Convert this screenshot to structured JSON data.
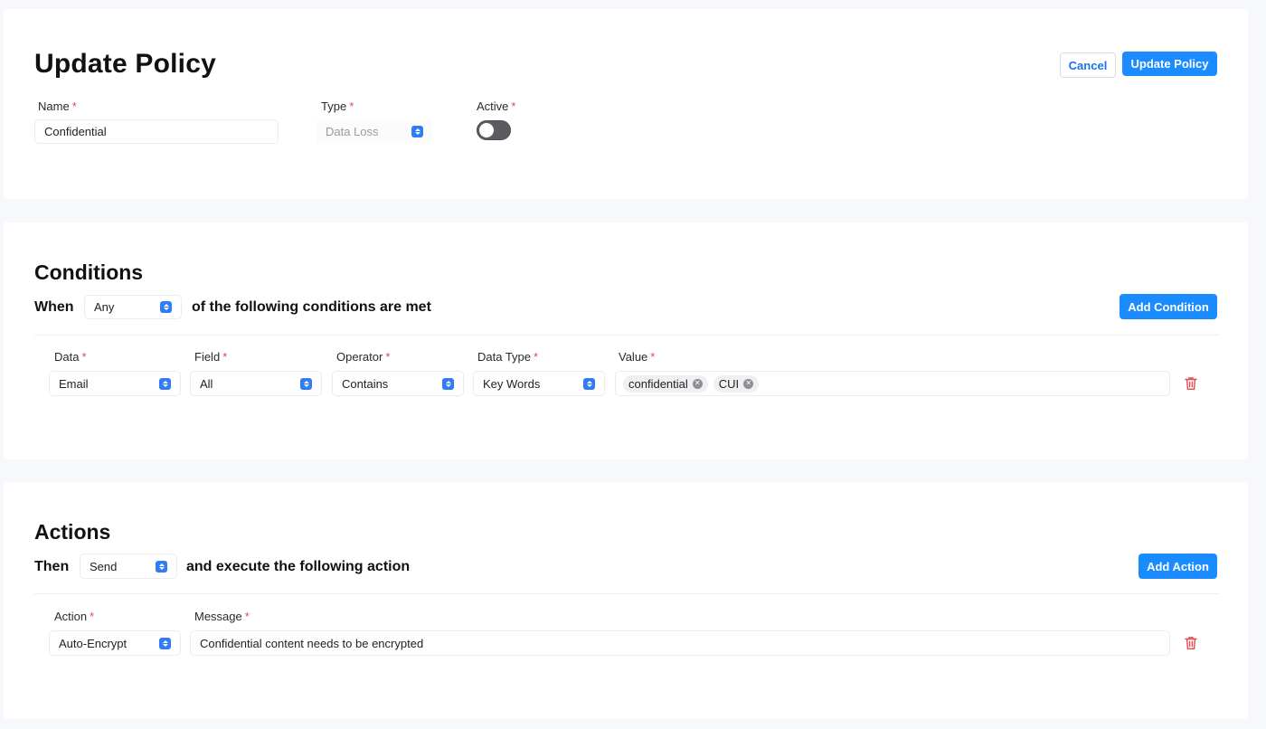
{
  "policy": {
    "title": "Update Policy",
    "cancel_label": "Cancel",
    "submit_label": "Update Policy",
    "name_label": "Name",
    "name_value": "Confidential",
    "type_label": "Type",
    "type_value": "Data Loss",
    "active_label": "Active",
    "required_mark": "*"
  },
  "conditions": {
    "title": "Conditions",
    "when_label": "When",
    "match_value": "Any",
    "match_suffix": "of the following conditions are met",
    "add_label": "Add Condition",
    "columns": {
      "data": "Data",
      "field": "Field",
      "operator": "Operator",
      "data_type": "Data Type",
      "value": "Value"
    },
    "row": {
      "data": "Email",
      "field": "All",
      "operator": "Contains",
      "data_type": "Key Words",
      "tags": [
        "confidential",
        "CUI"
      ]
    }
  },
  "actions": {
    "title": "Actions",
    "then_label": "Then",
    "mode_value": "Send",
    "mode_suffix": "and execute the following action",
    "add_label": "Add Action",
    "columns": {
      "action": "Action",
      "message": "Message"
    },
    "row": {
      "action": "Auto-Encrypt",
      "message": "Confidential content needs to be encrypted"
    }
  },
  "colors": {
    "accent": "#1a8cff",
    "danger": "#e5484d",
    "toggle_off": "#5b5b60"
  }
}
